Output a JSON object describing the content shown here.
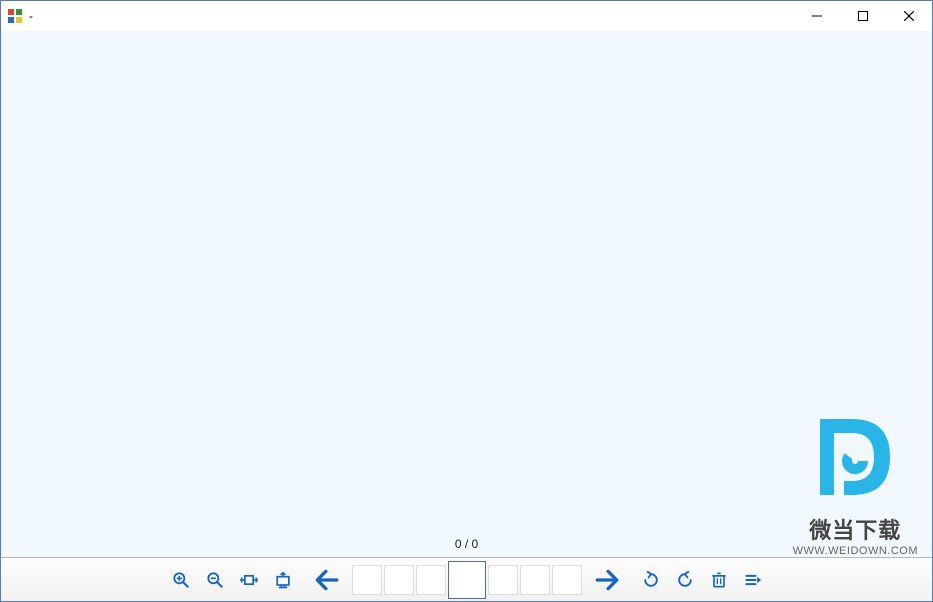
{
  "titlebar": {
    "title": "-"
  },
  "viewer": {
    "counter": "0 / 0"
  },
  "toolbar": {
    "zoom_in": "zoom-in",
    "zoom_out": "zoom-out",
    "fit_width": "fit-width",
    "fit_screen": "fit-screen",
    "prev": "previous",
    "next": "next",
    "rotate_ccw": "rotate-left",
    "rotate_cw": "rotate-right",
    "delete": "delete",
    "more": "more"
  },
  "watermark": {
    "brand": "D",
    "cn_text": "微当下载",
    "url": "WWW.WEIDOWN.COM"
  }
}
